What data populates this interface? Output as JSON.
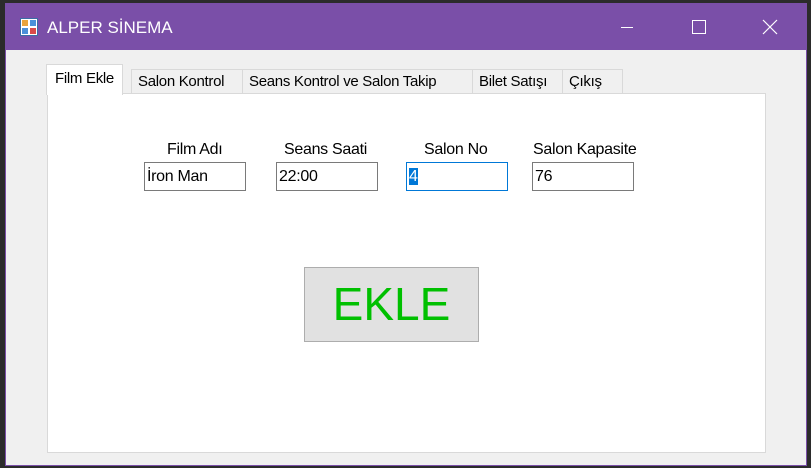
{
  "window": {
    "title": "ALPER SİNEMA",
    "accent_color": "#7a4fa8",
    "controls": {
      "minimize_icon": "minimize-icon",
      "maximize_icon": "maximize-icon",
      "close_icon": "close-icon"
    }
  },
  "tabs": [
    {
      "label": "Film Ekle",
      "active": true
    },
    {
      "label": "Salon Kontrol",
      "active": false
    },
    {
      "label": "Seans Kontrol ve Salon Takip",
      "active": false
    },
    {
      "label": "Bilet Satışı",
      "active": false
    },
    {
      "label": "Çıkış",
      "active": false
    }
  ],
  "form": {
    "film_adi": {
      "label": "Film Adı",
      "value": "İron Man"
    },
    "seans_saati": {
      "label": "Seans Saati",
      "value": "22:00"
    },
    "salon_no": {
      "label": "Salon No",
      "value": "4",
      "selected": true
    },
    "salon_kapasite": {
      "label": "Salon Kapasite",
      "value": "76"
    }
  },
  "ekle_button": {
    "label": "EKLE",
    "text_color": "#00c000"
  }
}
